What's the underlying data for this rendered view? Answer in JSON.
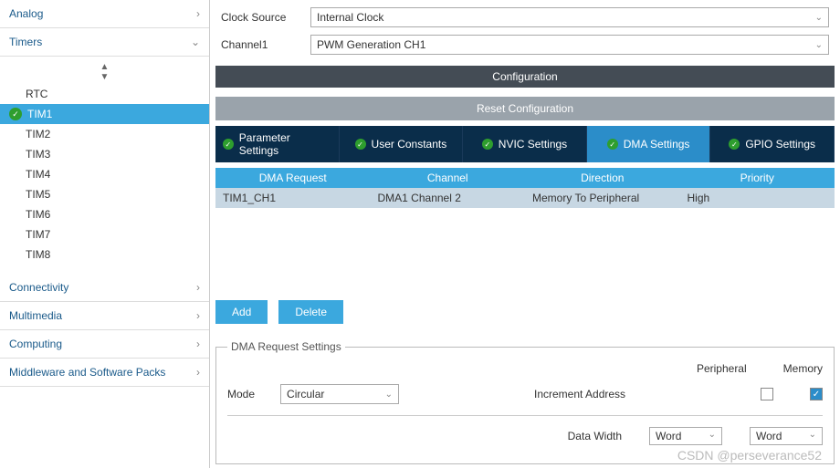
{
  "sidebar": {
    "analog": "Analog",
    "timers": "Timers",
    "items": [
      "RTC",
      "TIM1",
      "TIM2",
      "TIM3",
      "TIM4",
      "TIM5",
      "TIM6",
      "TIM7",
      "TIM8"
    ],
    "connectivity": "Connectivity",
    "multimedia": "Multimedia",
    "computing": "Computing",
    "middleware": "Middleware and Software Packs"
  },
  "top": {
    "clock_src_lbl": "Clock Source",
    "clock_src": "Internal Clock",
    "ch1_lbl": "Channel1",
    "ch1": "PWM Generation CH1"
  },
  "cfg_title": "Configuration",
  "reset": "Reset Configuration",
  "tabs": [
    "Parameter Settings",
    "User Constants",
    "NVIC Settings",
    "DMA Settings",
    "GPIO Settings"
  ],
  "tbl": {
    "headers": [
      "DMA Request",
      "Channel",
      "Direction",
      "Priority"
    ],
    "row": [
      "TIM1_CH1",
      "DMA1 Channel 2",
      "Memory To Peripheral",
      "High"
    ]
  },
  "add": "Add",
  "delete": "Delete",
  "dma": {
    "legend": "DMA Request Settings",
    "mode_lbl": "Mode",
    "mode": "Circular",
    "periph": "Peripheral",
    "mem": "Memory",
    "inc_addr": "Increment Address",
    "data_width": "Data Width",
    "dw1": "Word",
    "dw2": "Word"
  },
  "watermark": "CSDN @perseverance52"
}
